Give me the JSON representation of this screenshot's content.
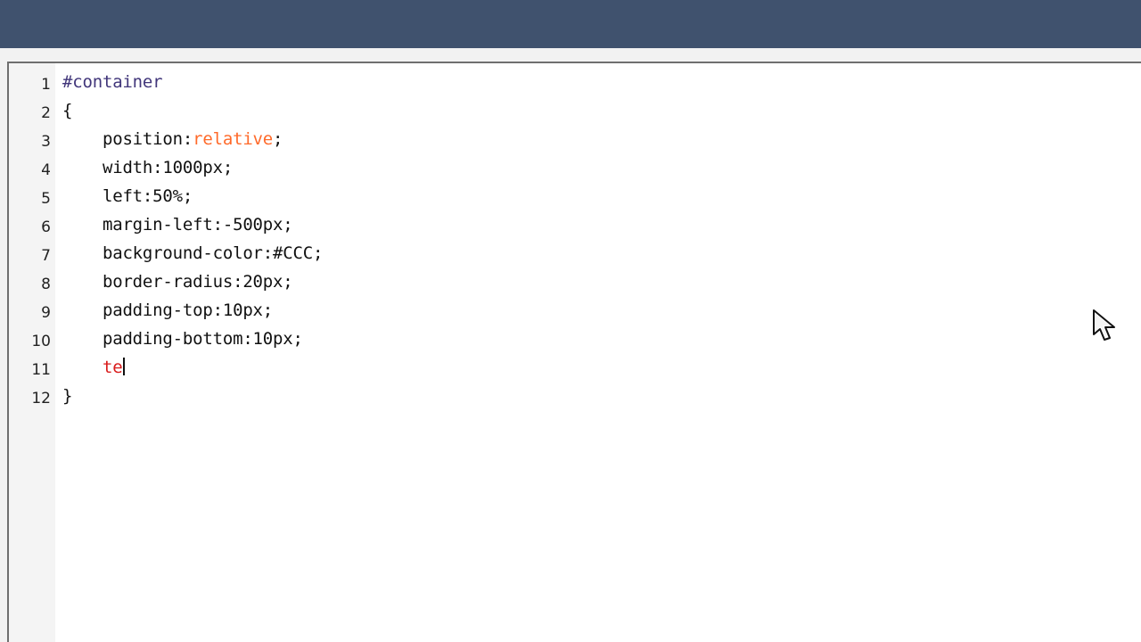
{
  "editor": {
    "lines": [
      {
        "number": "1",
        "selector": "#container"
      },
      {
        "number": "2",
        "text": "{"
      },
      {
        "number": "3",
        "indent": "    ",
        "property": "position:",
        "value": "relative",
        "end": ";"
      },
      {
        "number": "4",
        "indent": "    ",
        "text": "width:1000px;"
      },
      {
        "number": "5",
        "indent": "    ",
        "text": "left:50%;"
      },
      {
        "number": "6",
        "indent": "    ",
        "text": "margin-left:-500px;"
      },
      {
        "number": "7",
        "indent": "    ",
        "text": "background-color:#CCC;"
      },
      {
        "number": "8",
        "indent": "    ",
        "text": "border-radius:20px;"
      },
      {
        "number": "9",
        "indent": "    ",
        "text": "padding-top:10px;"
      },
      {
        "number": "10",
        "indent": "    ",
        "text": "padding-bottom:10px;"
      },
      {
        "number": "11",
        "indent": "    ",
        "typing": "te"
      },
      {
        "number": "12",
        "text": "}"
      }
    ]
  },
  "colors": {
    "title_bar": "#40526e",
    "selector": "#41367a",
    "value_keyword": "#ff6a2a",
    "typing": "#d91b1b"
  },
  "icons": {
    "mouse_pointer": "mouse-pointer-icon"
  }
}
